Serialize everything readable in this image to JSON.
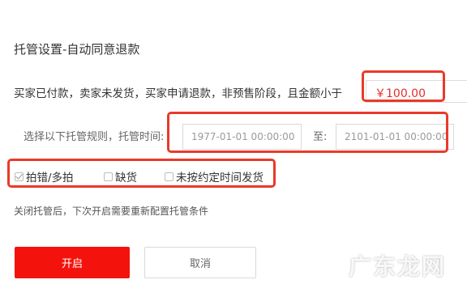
{
  "title": "托管设置-自动同意退款",
  "condition_text": "买家已付款，卖家未发货，买家申请退款，非预售阶段，且金额小于",
  "amount": "￥100.00",
  "rule_label": "选择以下托管规则，托管时间:",
  "start_date": "1977-01-01 00:00:00",
  "to_label": "至:",
  "end_date": "2101-01-01 00:00:00",
  "options": [
    {
      "label": "拍错/多拍",
      "checked": true
    },
    {
      "label": "缺货",
      "checked": false
    },
    {
      "label": "未按约定时间发货",
      "checked": false
    }
  ],
  "note": "关闭托管后，下次开启需要重新配置托管条件",
  "buttons": {
    "open": "开启",
    "cancel": "取消"
  },
  "watermark": "广东龙网",
  "colors": {
    "primary": "#f4130c",
    "highlight": "#e93a2a",
    "amount": "#e52d2d"
  }
}
